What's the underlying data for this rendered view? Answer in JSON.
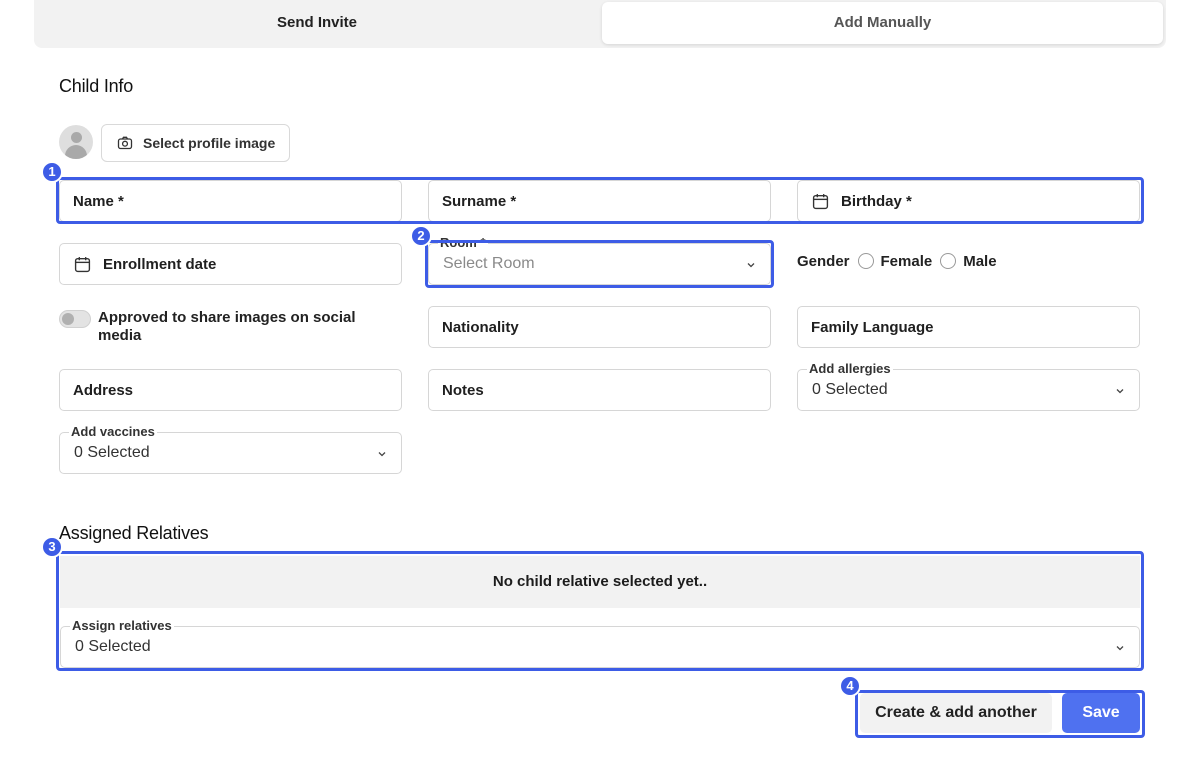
{
  "tabs": {
    "send_invite": "Send Invite",
    "add_manually": "Add Manually"
  },
  "child_info": {
    "title": "Child Info",
    "select_profile_image": "Select profile image",
    "name_label": "Name *",
    "surname_label": "Surname *",
    "birthday_label": "Birthday *",
    "enrollment_date_label": "Enrollment date",
    "room": {
      "legend": "Room *",
      "placeholder": "Select Room"
    },
    "gender": {
      "label": "Gender",
      "options": [
        "Female",
        "Male"
      ]
    },
    "approved_share_line1": "Approved to share images on social",
    "approved_share_line2": "media",
    "nationality_label": "Nationality",
    "family_language_label": "Family Language",
    "address_label": "Address",
    "notes_label": "Notes",
    "allergies": {
      "legend": "Add allergies",
      "value": "0 Selected"
    },
    "vaccines": {
      "legend": "Add vaccines",
      "value": "0 Selected"
    }
  },
  "relatives": {
    "title": "Assigned Relatives",
    "empty_message": "No child relative selected yet..",
    "assign": {
      "legend": "Assign relatives",
      "value": "0 Selected"
    }
  },
  "actions": {
    "create_another": "Create & add another",
    "save": "Save"
  },
  "badges": [
    "1",
    "2",
    "3",
    "4"
  ],
  "colors": {
    "highlight": "#3d5ce6",
    "primary_button": "#4f71f0"
  }
}
